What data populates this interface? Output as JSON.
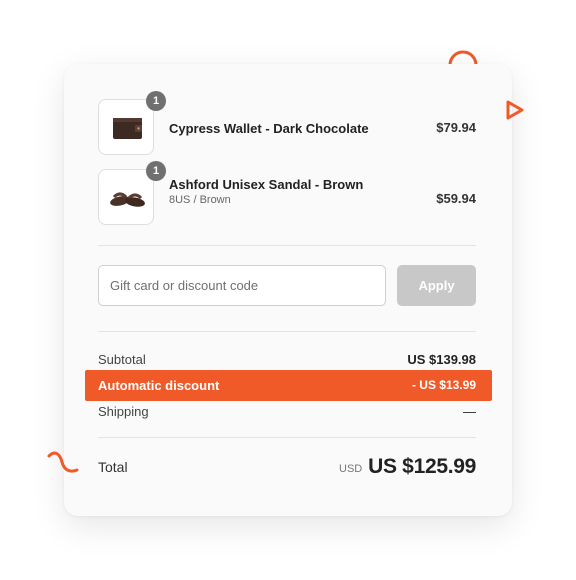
{
  "cart": {
    "items": [
      {
        "title": "Cypress Wallet - Dark Chocolate",
        "variant": "",
        "quantity": "1",
        "price": "$79.94",
        "image": "wallet-image"
      },
      {
        "title": "Ashford Unisex Sandal - Brown",
        "variant": "8US / Brown",
        "quantity": "1",
        "price": "$59.94",
        "image": "sandal-image"
      }
    ]
  },
  "discount_form": {
    "placeholder": "Gift card or discount code",
    "value": "",
    "apply_label": "Apply"
  },
  "summary": {
    "subtotal_label": "Subtotal",
    "subtotal_value": "US $139.98",
    "discount_label": "Automatic discount",
    "discount_value": "- US $13.99",
    "shipping_label": "Shipping",
    "shipping_value": "—",
    "total_label": "Total",
    "total_currency": "USD",
    "total_value": "US $125.99"
  },
  "colors": {
    "accent": "#f05a28",
    "button_disabled": "#c8c8c8",
    "badge": "#707070"
  },
  "decorations": [
    "circle-icon",
    "play-triangle-icon",
    "squiggle-icon"
  ]
}
